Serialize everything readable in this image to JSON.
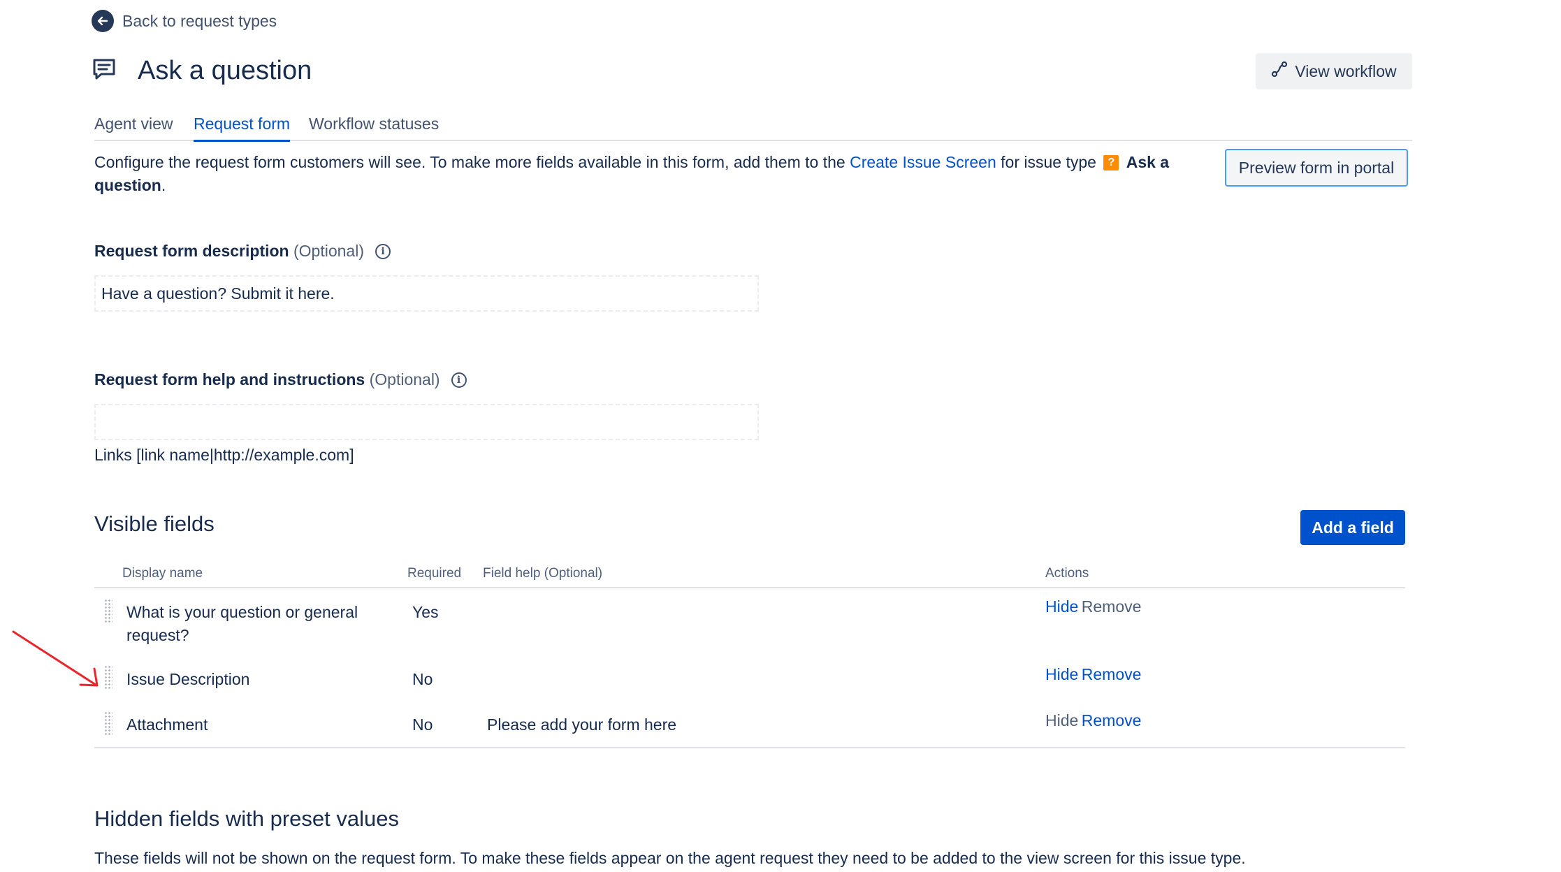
{
  "nav": {
    "back_label": "Back to request types"
  },
  "header": {
    "title": "Ask a question",
    "view_workflow": "View workflow"
  },
  "tabs": [
    {
      "label": "Agent view",
      "active": false
    },
    {
      "label": "Request form",
      "active": true
    },
    {
      "label": "Workflow statuses",
      "active": false
    }
  ],
  "intro": {
    "text_before": "Configure the request form customers will see. To make more fields available in this form, add them to the ",
    "link": "Create Issue Screen",
    "text_middle": " for issue type ",
    "issue_type_icon": "?",
    "issue_type": "Ask a question",
    "text_end": "."
  },
  "preview_button": "Preview form in portal",
  "description_field": {
    "label": "Request form description",
    "optional": "(Optional)",
    "value": "Have a question? Submit it here."
  },
  "help_field": {
    "label": "Request form help and instructions",
    "optional": "(Optional)",
    "value": "",
    "hint": "Links [link name|http://example.com]"
  },
  "visible_fields": {
    "title": "Visible fields",
    "add_button": "Add a field",
    "columns": {
      "display_name": "Display name",
      "required": "Required",
      "field_help": "Field help (Optional)",
      "actions": "Actions"
    },
    "rows": [
      {
        "name": "What is your question or general request?",
        "required": "Yes",
        "help": "",
        "hide": "Hide",
        "remove": "Remove"
      },
      {
        "name": "Issue Description",
        "required": "No",
        "help": "",
        "hide": "Hide",
        "remove": "Remove"
      },
      {
        "name": "Attachment",
        "required": "No",
        "help": "Please add your form here",
        "hide": "Hide",
        "remove": "Remove"
      }
    ]
  },
  "hidden_fields": {
    "title": "Hidden fields with preset values",
    "description": "These fields will not be shown on the request form. To make these fields appear on the agent request they need to be added to the view screen for this issue type."
  },
  "colors": {
    "link": "#0052cc",
    "primary_button": "#0052cc",
    "annotation_arrow": "#e8262a",
    "issue_type_badge": "#ff8b00"
  }
}
